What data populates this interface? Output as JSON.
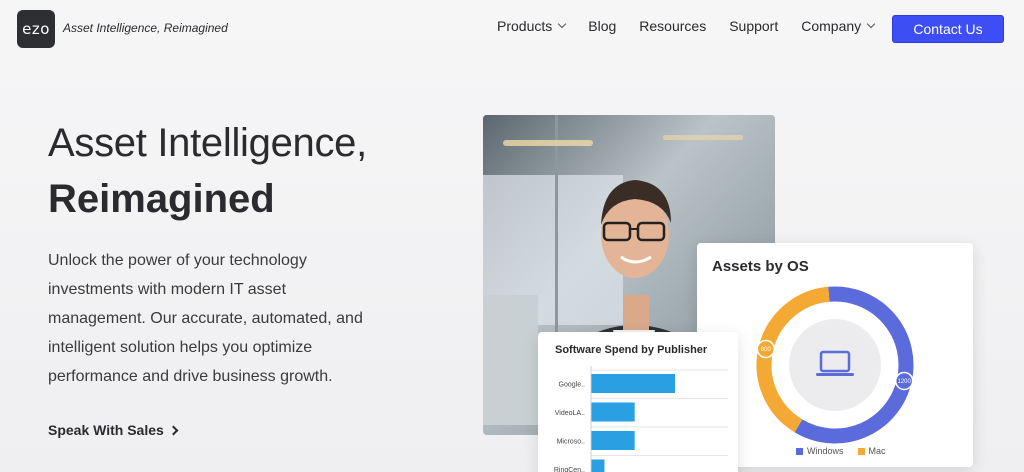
{
  "brand": {
    "logo_text": "ezo",
    "tagline": "Asset Intelligence, Reimagined"
  },
  "nav": {
    "links": [
      {
        "label": "Products",
        "dropdown": true
      },
      {
        "label": "Blog",
        "dropdown": false
      },
      {
        "label": "Resources",
        "dropdown": false
      },
      {
        "label": "Support",
        "dropdown": false
      },
      {
        "label": "Company",
        "dropdown": true
      }
    ],
    "contact_label": "Contact Us",
    "accent_color": "#3d4ef5"
  },
  "hero": {
    "title_line1": "Asset Intelligence,",
    "title_line2": "Reimagined",
    "description": "Unlock the power of your technology investments with modern IT asset management. Our accurate, automated, and intelligent solution helps you optimize performance and drive business growth.",
    "cta_label": "Speak With Sales"
  },
  "os_card": {
    "title": "Assets by OS",
    "icon": "laptop-icon",
    "segments": [
      {
        "label": "Windows",
        "value": 1200,
        "color": "#5b6bdc"
      },
      {
        "label": "Mac",
        "value": 800,
        "color": "#f5a935"
      }
    ],
    "value_labels": [
      "800",
      "1200"
    ]
  },
  "spend_card": {
    "title": "Software Spend by Publisher",
    "bar_color": "#2aa0e2",
    "bars": [
      {
        "label": "Google..",
        "value": 100
      },
      {
        "label": "VideoLA..",
        "value": 52
      },
      {
        "label": "Microso..",
        "value": 52
      },
      {
        "label": "RingCen..",
        "value": 16
      }
    ]
  }
}
